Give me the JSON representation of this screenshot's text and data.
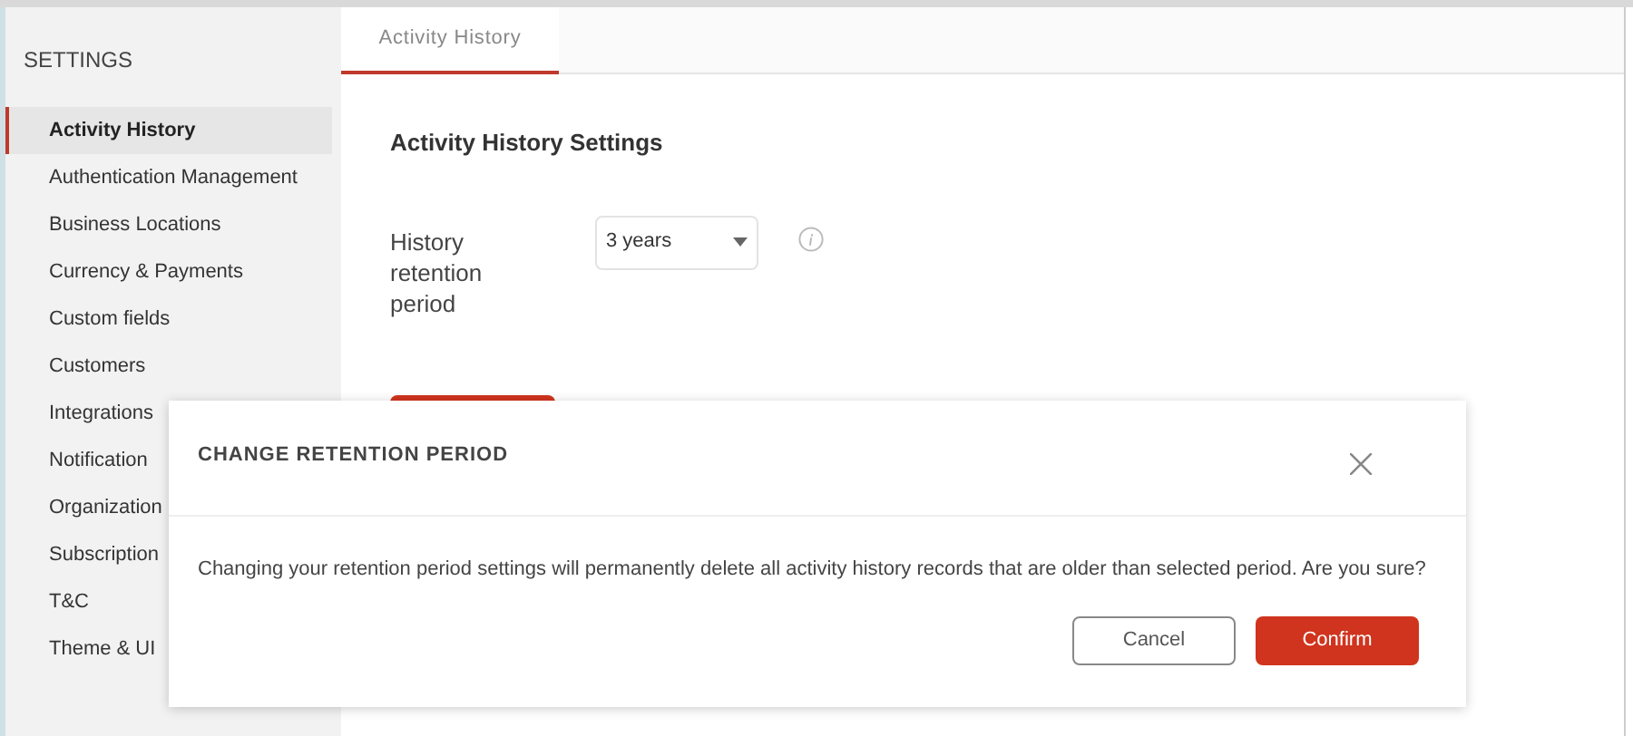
{
  "sidebar": {
    "title": "SETTINGS",
    "items": [
      {
        "label": "Activity History",
        "selected": true
      },
      {
        "label": "Authentication Management",
        "selected": false
      },
      {
        "label": "Business Locations",
        "selected": false
      },
      {
        "label": "Currency & Payments",
        "selected": false
      },
      {
        "label": "Custom fields",
        "selected": false
      },
      {
        "label": "Customers",
        "selected": false
      },
      {
        "label": "Integrations",
        "selected": false
      },
      {
        "label": "Notification",
        "selected": false
      },
      {
        "label": "Organization",
        "selected": false
      },
      {
        "label": "Subscription",
        "selected": false
      },
      {
        "label": "T&C",
        "selected": false
      },
      {
        "label": "Theme & UI",
        "selected": false
      }
    ]
  },
  "tabs": [
    {
      "label": "Activity History",
      "selected": true
    }
  ],
  "section": {
    "title": "Activity History Settings",
    "field": {
      "label": "History retention period",
      "value": "3 years"
    }
  },
  "dialog": {
    "title": "CHANGE RETENTION PERIOD",
    "message": "Changing your retention period settings will permanently delete all activity history records that are older than selected period. Are you sure?",
    "buttons": [
      {
        "label": "Cancel",
        "kind": "secondary"
      },
      {
        "label": "Confirm",
        "kind": "primary"
      }
    ]
  }
}
